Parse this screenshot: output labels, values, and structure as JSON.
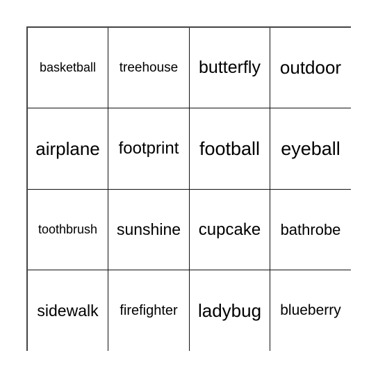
{
  "board": {
    "rows": [
      [
        "basketball",
        "treehouse",
        "butterfly",
        "outdoor"
      ],
      [
        "airplane",
        "footprint",
        "football",
        "eyeball"
      ],
      [
        "toothbrush",
        "sunshine",
        "cupcake",
        "bathrobe"
      ],
      [
        "sidewalk",
        "firefighter",
        "ladybug",
        "blueberry"
      ]
    ]
  }
}
